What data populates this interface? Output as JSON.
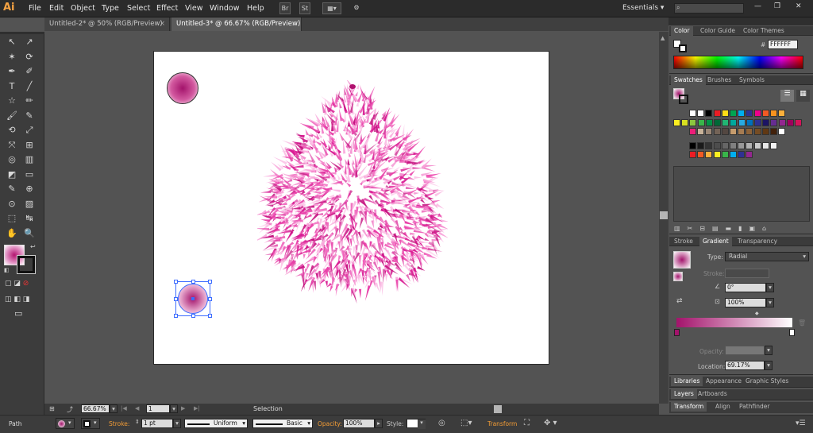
{
  "app": {
    "logo": "Ai"
  },
  "menu": [
    "File",
    "Edit",
    "Object",
    "Type",
    "Select",
    "Effect",
    "View",
    "Window",
    "Help"
  ],
  "menubar_buttons": {
    "bridge": "Br",
    "stock": "St",
    "arrange": "▦▾",
    "gpu": "⚙"
  },
  "workspace": {
    "label": "Essentials",
    "arrow": "▾",
    "search_icon": "search-icon"
  },
  "window_controls": {
    "minimize": "—",
    "restore": "❐",
    "close": "✕"
  },
  "tabs": [
    {
      "label": "Untitled-2* @ 50% (RGB/Preview)",
      "close": "×",
      "active": false
    },
    {
      "label": "Untitled-3* @ 66.67% (RGB/Preview)",
      "close": "×",
      "active": true
    }
  ],
  "toolbar": {
    "tools": [
      "↖",
      "↗",
      "✶",
      "⟳",
      "✒",
      "✐",
      "T",
      "╱",
      "☆",
      "✏",
      "🖌",
      "✎",
      "⟲",
      "⤢",
      "⤧",
      "⊞",
      "◎",
      "▥",
      "◩",
      "▭",
      "✎",
      "⊕",
      "⊙",
      "▨",
      "⬚",
      "↹",
      "✋",
      "🔍"
    ],
    "fill_label": "fill",
    "mode_icons": [
      "▢",
      "◪",
      "⊘"
    ],
    "draw_modes": [
      "◫",
      "◧",
      "◨"
    ],
    "screen_mode": "▭"
  },
  "canvas": {
    "selection_label": "Selection"
  },
  "color_panel": {
    "tabs": [
      "Color",
      "Color Guide",
      "Color Themes"
    ],
    "hex_prefix": "#",
    "hex_value": "FFFFFF"
  },
  "swatches_panel": {
    "tabs": [
      "Swatches",
      "Brushes",
      "Symbols"
    ],
    "row1": [
      "#ffffff",
      "#ffffff",
      "#000000",
      "#eb1c24",
      "#ffde17",
      "#00a551",
      "#00aeef",
      "#2e3192",
      "#ec008c",
      "#f15a24",
      "#f7931e",
      "#fbb03b"
    ],
    "row2": [
      "#fcee21",
      "#d9e021",
      "#8cc63f",
      "#39b54a",
      "#009245",
      "#006837",
      "#22b573",
      "#00a99d",
      "#29abe2",
      "#0071bc",
      "#2e3192",
      "#1b1464",
      "#662d91",
      "#93278f",
      "#9e005d",
      "#d4145a"
    ],
    "row3": [
      "#ed1e79",
      "#c7b299",
      "#998675",
      "#736357",
      "#534741",
      "#c69c6d",
      "#a67c52",
      "#8c6239",
      "#754c24",
      "#603813",
      "#42210b",
      "#ffffff"
    ],
    "row4": [
      "#000000",
      "#1a1a1a",
      "#333333",
      "#4d4d4d",
      "#666666",
      "#808080",
      "#999999",
      "#b3b3b3",
      "#cccccc",
      "#e6e6e6",
      "#f2f2f2"
    ],
    "row5": [
      "#ed1c24",
      "#f15a24",
      "#fbb03b",
      "#fcee21",
      "#39b54a",
      "#00aeef",
      "#2e3192",
      "#93278f"
    ]
  },
  "gradient_panel": {
    "tabs": [
      "Stroke",
      "Gradient",
      "Transparency"
    ],
    "type_label": "Type:",
    "type_value": "Radial",
    "stroke_label": "Stroke:",
    "angle_value": "0°",
    "aspect_value": "100%",
    "opacity_label": "Opacity:",
    "location_label": "Location:",
    "location_value": "69.17%",
    "stop_colors": [
      "#a3136b",
      "#ffffff"
    ]
  },
  "bottom_panels": {
    "tabs1": [
      "Libraries",
      "Appearance",
      "Graphic Styles"
    ],
    "tabs2": [
      "Layers",
      "Artboards"
    ],
    "tabs3": [
      "Transform",
      "Align",
      "Pathfinder"
    ]
  },
  "zoom_bar": {
    "zoom": "66.67%",
    "page": "1",
    "first": "|◀",
    "prev": "◀",
    "next": "▶",
    "last": "▶|"
  },
  "control_bar": {
    "object_type": "Path",
    "stroke_label": "Stroke:",
    "stroke_weight": "1 pt",
    "profile": "Uniform",
    "brush": "Basic",
    "opacity_label": "Opacity:",
    "opacity_value": "100%",
    "style_label": "Style:",
    "transform_label": "Transform"
  }
}
